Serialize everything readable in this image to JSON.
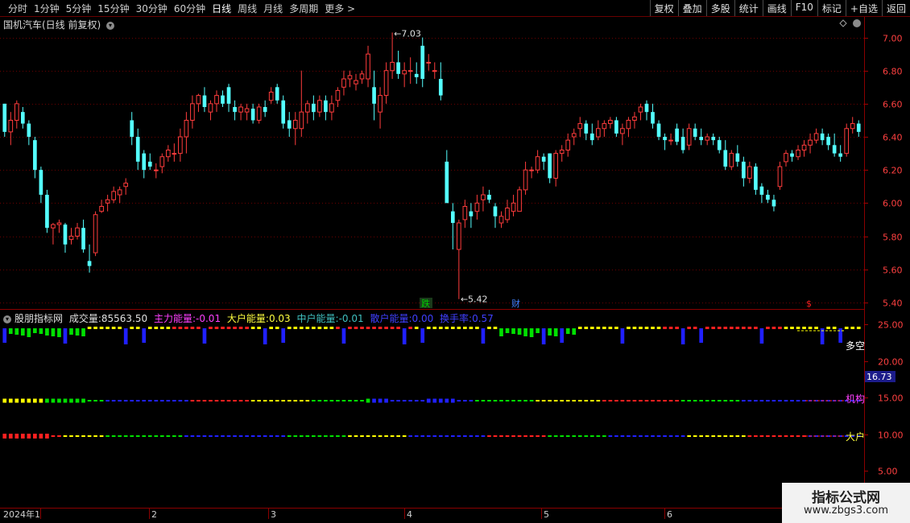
{
  "toolbar": {
    "periods": [
      "分时",
      "1分钟",
      "5分钟",
      "15分钟",
      "30分钟",
      "60分钟",
      "日线",
      "周线",
      "月线",
      "多周期",
      "更多"
    ],
    "active_period": "日线",
    "more_arrow": ">",
    "buttons": [
      "复权",
      "叠加",
      "多股",
      "统计",
      "画线",
      "F10",
      "标记",
      "+自选",
      "返回"
    ]
  },
  "price_panel": {
    "title": "国机汽车(日线 前复权)",
    "y_ticks": [
      "7.00",
      "6.80",
      "6.60",
      "6.40",
      "6.20",
      "6.00",
      "5.80",
      "5.60",
      "5.40"
    ],
    "high_label": "7.03",
    "low_label": "5.42",
    "markers": [
      {
        "text": "跌",
        "color": "#00c800"
      },
      {
        "text": "财",
        "color": "#2060ff"
      },
      {
        "text": "$",
        "color": "#ff2020"
      }
    ],
    "candle_colors": {
      "up": "#ff3c3c",
      "down": "#54ffff"
    }
  },
  "indicator_panel": {
    "name": "股朋指标网",
    "items": [
      {
        "label": "成交量:",
        "value": "85563.50",
        "color": "#e0e0e0"
      },
      {
        "label": "主力能量:",
        "value": "-0.01",
        "color": "#ff40ff"
      },
      {
        "label": "大户能量:",
        "value": "0.03",
        "color": "#ffff40"
      },
      {
        "label": "中户能量:",
        "value": "-0.01",
        "color": "#40c0c0"
      },
      {
        "label": "散户能量:",
        "value": "0.00",
        "color": "#4040ff"
      },
      {
        "label": "换手率:",
        "value": "0.57",
        "color": "#4040ff"
      }
    ],
    "y_ticks": [
      "25.00",
      "20.00",
      "15.00",
      "10.00",
      "5.00"
    ],
    "current_value": "16.73",
    "row_labels": [
      {
        "text": "多空",
        "color": "#ffffff"
      },
      {
        "text": "机构",
        "color": "#ff40ff"
      },
      {
        "text": "大户",
        "color": "#ffff40"
      }
    ],
    "colors": {
      "red": "#ff2020",
      "yellow": "#ffff00",
      "green": "#00e000",
      "blue": "#2020ff"
    }
  },
  "time_axis": {
    "labels": [
      "2024年1",
      "2",
      "3",
      "4",
      "5",
      "6"
    ]
  },
  "watermark": {
    "line1": "指标公式网",
    "line2": "www.zbgs3.com"
  },
  "chart_data": {
    "type": "candlestick",
    "ylim": [
      5.37,
      7.1
    ],
    "candles": [
      [
        6.6,
        6.6,
        6.4,
        6.43
      ],
      [
        6.43,
        6.55,
        6.35,
        6.5
      ],
      [
        6.5,
        6.62,
        6.45,
        6.6
      ],
      [
        6.55,
        6.58,
        6.45,
        6.48
      ],
      [
        6.48,
        6.5,
        6.35,
        6.4
      ],
      [
        6.38,
        6.4,
        6.15,
        6.2
      ],
      [
        6.2,
        6.22,
        6.0,
        6.05
      ],
      [
        6.05,
        6.08,
        5.82,
        5.85
      ],
      [
        5.85,
        5.88,
        5.75,
        5.87
      ],
      [
        5.87,
        5.9,
        5.82,
        5.88
      ],
      [
        5.87,
        5.88,
        5.7,
        5.75
      ],
      [
        5.78,
        5.85,
        5.75,
        5.8
      ],
      [
        5.8,
        5.88,
        5.78,
        5.85
      ],
      [
        5.85,
        5.9,
        5.7,
        5.72
      ],
      [
        5.65,
        5.75,
        5.58,
        5.62
      ],
      [
        5.7,
        5.95,
        5.68,
        5.93
      ],
      [
        5.95,
        6.02,
        5.94,
        5.98
      ],
      [
        6.0,
        6.05,
        5.95,
        6.02
      ],
      [
        6.02,
        6.1,
        6.0,
        6.07
      ],
      [
        6.05,
        6.1,
        6.0,
        6.08
      ],
      [
        6.1,
        6.15,
        6.05,
        6.12
      ],
      [
        6.5,
        6.55,
        6.35,
        6.4
      ],
      [
        6.4,
        6.45,
        6.2,
        6.25
      ],
      [
        6.3,
        6.32,
        6.15,
        6.2
      ],
      [
        6.25,
        6.3,
        6.2,
        6.22
      ],
      [
        6.2,
        6.24,
        6.15,
        6.2
      ],
      [
        6.22,
        6.3,
        6.18,
        6.28
      ],
      [
        6.28,
        6.35,
        6.25,
        6.32
      ],
      [
        6.3,
        6.36,
        6.25,
        6.3
      ],
      [
        6.3,
        6.45,
        6.25,
        6.4
      ],
      [
        6.4,
        6.55,
        6.3,
        6.5
      ],
      [
        6.5,
        6.65,
        6.45,
        6.6
      ],
      [
        6.6,
        6.66,
        6.55,
        6.65
      ],
      [
        6.65,
        6.7,
        6.55,
        6.58
      ],
      [
        6.55,
        6.62,
        6.5,
        6.6
      ],
      [
        6.6,
        6.68,
        6.55,
        6.65
      ],
      [
        6.65,
        6.68,
        6.58,
        6.6
      ],
      [
        6.7,
        6.72,
        6.55,
        6.6
      ],
      [
        6.58,
        6.62,
        6.5,
        6.55
      ],
      [
        6.55,
        6.6,
        6.5,
        6.58
      ],
      [
        6.55,
        6.6,
        6.5,
        6.57
      ],
      [
        6.57,
        6.6,
        6.48,
        6.5
      ],
      [
        6.5,
        6.6,
        6.48,
        6.58
      ],
      [
        6.58,
        6.62,
        6.52,
        6.55
      ],
      [
        6.62,
        6.7,
        6.6,
        6.67
      ],
      [
        6.7,
        6.72,
        6.6,
        6.62
      ],
      [
        6.62,
        6.65,
        6.45,
        6.48
      ],
      [
        6.5,
        6.55,
        6.4,
        6.45
      ],
      [
        6.45,
        6.55,
        6.35,
        6.5
      ],
      [
        6.45,
        6.8,
        6.4,
        6.55
      ],
      [
        6.55,
        6.62,
        6.48,
        6.6
      ],
      [
        6.6,
        6.65,
        6.5,
        6.55
      ],
      [
        6.55,
        6.65,
        6.52,
        6.62
      ],
      [
        6.62,
        6.65,
        6.5,
        6.55
      ],
      [
        6.55,
        6.65,
        6.5,
        6.6
      ],
      [
        6.62,
        6.7,
        6.58,
        6.68
      ],
      [
        6.7,
        6.8,
        6.65,
        6.75
      ],
      [
        6.75,
        6.8,
        6.7,
        6.77
      ],
      [
        6.72,
        6.78,
        6.68,
        6.74
      ],
      [
        6.75,
        6.8,
        6.72,
        6.78
      ],
      [
        6.75,
        6.95,
        6.7,
        6.9
      ],
      [
        6.7,
        6.8,
        6.5,
        6.6
      ],
      [
        6.55,
        6.7,
        6.45,
        6.65
      ],
      [
        6.65,
        6.85,
        6.6,
        6.8
      ],
      [
        6.8,
        7.03,
        6.75,
        6.85
      ],
      [
        6.85,
        6.92,
        6.75,
        6.78
      ],
      [
        6.78,
        6.85,
        6.7,
        6.8
      ],
      [
        6.8,
        6.88,
        6.72,
        6.8
      ],
      [
        6.78,
        6.85,
        6.72,
        6.76
      ],
      [
        6.95,
        7.0,
        6.7,
        6.75
      ],
      [
        6.85,
        6.9,
        6.8,
        6.85
      ],
      [
        6.8,
        6.85,
        6.75,
        6.8
      ],
      [
        6.75,
        6.85,
        6.62,
        6.65
      ],
      [
        6.25,
        6.32,
        6.05,
        6.0
      ],
      [
        5.95,
        6.0,
        5.72,
        5.88
      ],
      [
        5.72,
        5.9,
        5.42,
        5.88
      ],
      [
        5.9,
        6.02,
        5.85,
        5.98
      ],
      [
        5.95,
        6.0,
        5.85,
        5.92
      ],
      [
        5.95,
        6.05,
        5.9,
        6.0
      ],
      [
        6.02,
        6.1,
        5.95,
        6.05
      ],
      [
        6.05,
        6.08,
        6.0,
        6.02
      ],
      [
        5.98,
        6.0,
        5.85,
        5.92
      ],
      [
        5.88,
        5.95,
        5.85,
        5.92
      ],
      [
        5.9,
        6.02,
        5.88,
        5.97
      ],
      [
        5.95,
        6.05,
        5.92,
        6.0
      ],
      [
        5.95,
        6.1,
        5.95,
        6.08
      ],
      [
        6.08,
        6.25,
        6.05,
        6.2
      ],
      [
        6.2,
        6.22,
        6.15,
        6.2
      ],
      [
        6.2,
        6.32,
        6.18,
        6.28
      ],
      [
        6.28,
        6.3,
        6.2,
        6.25
      ],
      [
        6.3,
        6.3,
        6.12,
        6.15
      ],
      [
        6.15,
        6.32,
        6.1,
        6.3
      ],
      [
        6.3,
        6.35,
        6.25,
        6.32
      ],
      [
        6.32,
        6.42,
        6.28,
        6.38
      ],
      [
        6.4,
        6.45,
        6.35,
        6.42
      ],
      [
        6.45,
        6.52,
        6.4,
        6.48
      ],
      [
        6.48,
        6.5,
        6.38,
        6.42
      ],
      [
        6.42,
        6.48,
        6.35,
        6.38
      ],
      [
        6.4,
        6.5,
        6.38,
        6.45
      ],
      [
        6.45,
        6.5,
        6.4,
        6.48
      ],
      [
        6.48,
        6.52,
        6.45,
        6.5
      ],
      [
        6.5,
        6.52,
        6.4,
        6.42
      ],
      [
        6.42,
        6.48,
        6.35,
        6.45
      ],
      [
        6.45,
        6.52,
        6.4,
        6.5
      ],
      [
        6.5,
        6.55,
        6.45,
        6.52
      ],
      [
        6.55,
        6.6,
        6.5,
        6.58
      ],
      [
        6.6,
        6.62,
        6.5,
        6.55
      ],
      [
        6.55,
        6.6,
        6.45,
        6.48
      ],
      [
        6.48,
        6.5,
        6.38,
        6.4
      ],
      [
        6.4,
        6.42,
        6.32,
        6.38
      ],
      [
        6.38,
        6.42,
        6.35,
        6.38
      ],
      [
        6.45,
        6.48,
        6.35,
        6.37
      ],
      [
        6.4,
        6.45,
        6.3,
        6.32
      ],
      [
        6.35,
        6.48,
        6.32,
        6.45
      ],
      [
        6.45,
        6.48,
        6.38,
        6.4
      ],
      [
        6.4,
        6.45,
        6.35,
        6.38
      ],
      [
        6.38,
        6.42,
        6.35,
        6.4
      ],
      [
        6.4,
        6.42,
        6.35,
        6.38
      ],
      [
        6.38,
        6.4,
        6.3,
        6.32
      ],
      [
        6.32,
        6.38,
        6.2,
        6.22
      ],
      [
        6.22,
        6.32,
        6.2,
        6.3
      ],
      [
        6.3,
        6.35,
        6.22,
        6.25
      ],
      [
        6.25,
        6.28,
        6.1,
        6.15
      ],
      [
        6.15,
        6.25,
        6.12,
        6.22
      ],
      [
        6.22,
        6.24,
        6.05,
        6.08
      ],
      [
        6.1,
        6.12,
        6.0,
        6.05
      ],
      [
        6.05,
        6.08,
        6.0,
        6.02
      ],
      [
        6.02,
        6.05,
        5.95,
        5.98
      ],
      [
        6.1,
        6.25,
        6.08,
        6.22
      ],
      [
        6.25,
        6.32,
        6.22,
        6.3
      ],
      [
        6.3,
        6.32,
        6.25,
        6.28
      ],
      [
        6.28,
        6.35,
        6.26,
        6.32
      ],
      [
        6.32,
        6.38,
        6.28,
        6.35
      ],
      [
        6.35,
        6.42,
        6.3,
        6.38
      ],
      [
        6.38,
        6.45,
        6.36,
        6.42
      ],
      [
        6.42,
        6.45,
        6.35,
        6.38
      ],
      [
        6.4,
        6.42,
        6.32,
        6.35
      ],
      [
        6.35,
        6.42,
        6.28,
        6.3
      ],
      [
        6.3,
        6.35,
        6.25,
        6.28
      ],
      [
        6.3,
        6.48,
        6.28,
        6.45
      ],
      [
        6.45,
        6.52,
        6.42,
        6.48
      ],
      [
        6.48,
        6.5,
        6.4,
        6.43
      ]
    ],
    "signal_rows": {
      "duokong_pattern": "ggggyyyyrrrryyyyrrrryyyyggggyyyyrrrrrryyyy",
      "jigou_pattern": "yygggbbbbrrryyygggbbbbbgggyyyrrrrgggbbbbbb",
      "dahu_pattern": "rrryyggggbbbbbgggyyybbbbrrrgggbbbbyyyrrrbbb"
    }
  }
}
